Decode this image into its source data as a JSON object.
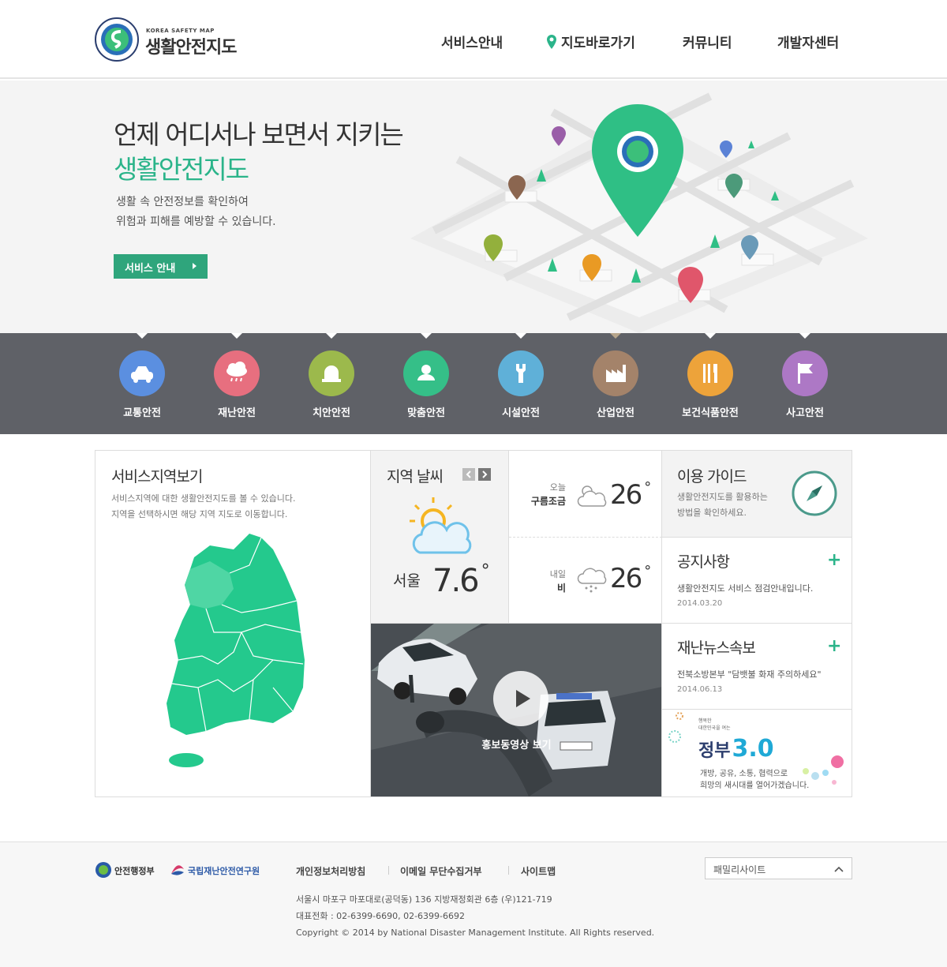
{
  "header": {
    "logo_sub": "KOREA SAFETY MAP",
    "logo_text": "생활안전지도",
    "nav": [
      "서비스안내",
      "지도바로가기",
      "커뮤니티",
      "개발자센터"
    ]
  },
  "hero": {
    "title_line1": "언제 어디서나 보면서 지키는",
    "title_line2": "생활안전지도",
    "desc_line1": "생활 속 안전정보를 확인하여",
    "desc_line2": "위험과 피해를 예방할 수 있습니다.",
    "button": "서비스 안내"
  },
  "categories": [
    {
      "label": "교통안전",
      "color": "#5b8fe0",
      "icon": "car-icon"
    },
    {
      "label": "재난안전",
      "color": "#e76f7f",
      "icon": "rain-cloud-icon"
    },
    {
      "label": "치안안전",
      "color": "#9cb94c",
      "icon": "siren-icon"
    },
    {
      "label": "맞춤안전",
      "color": "#35bf88",
      "icon": "person-icon"
    },
    {
      "label": "시설안전",
      "color": "#5fb0d8",
      "icon": "wrench-icon"
    },
    {
      "label": "산업안전",
      "color": "#a4836a",
      "icon": "factory-icon"
    },
    {
      "label": "보건식품안전",
      "color": "#eda33a",
      "icon": "fork-knife-icon"
    },
    {
      "label": "사고안전",
      "color": "#ad78c5",
      "icon": "flag-icon"
    }
  ],
  "region": {
    "title": "서비스지역보기",
    "desc_line1": "서비스지역에 대한 생활안전지도를 볼 수 있습니다.",
    "desc_line2": "지역을 선택하시면 해당 지역 지도로 이동합니다."
  },
  "weather": {
    "title": "지역 날씨",
    "city": "서울",
    "temp": "7.6",
    "today_label": "오늘",
    "today_cond": "구름조금",
    "today_temp": "26",
    "tomorrow_label": "내일",
    "tomorrow_cond": "비",
    "tomorrow_temp": "26"
  },
  "guide": {
    "title": "이용 가이드",
    "desc_line1": "생활안전지도를 활용하는",
    "desc_line2": "방법을 확인하세요."
  },
  "notice": {
    "title": "공지사항",
    "item": "생활안전지도 서비스 점검안내입니다.",
    "date": "2014.03.20"
  },
  "news": {
    "title": "재난뉴스속보",
    "item": "전북소방본부 \"담뱃불 화재 주의하세요\"",
    "date": "2014.06.13"
  },
  "video": {
    "label": "홍보동영상 보기"
  },
  "gov30": {
    "small1": "행복한",
    "small2": "대한민국을 여는",
    "title": "정부",
    "num": "3.0",
    "desc_line1": "개방, 공유, 소통, 협력으로",
    "desc_line2": "희망의 새시대를 열어가겠습니다."
  },
  "footer": {
    "logo1": "안전행정부",
    "logo2": "국립재난안전연구원",
    "links": [
      "개인정보처리방침",
      "이메일 무단수집거부",
      "사이트맵"
    ],
    "address": "서울시 마포구 마포대로(공덕동) 136 지방재정회관 6층 (우)121-719",
    "phone": "대표전화 : 02-6399-6690, 02-6399-6692",
    "copyright": "Copyright © 2014 by National Disaster Management Institute. All Rights reserved.",
    "family_site": "패밀리사이트"
  },
  "colors": {
    "brand_green": "#2bb48a",
    "category_bar": "#5f6167",
    "map_green": "#24c98d"
  }
}
